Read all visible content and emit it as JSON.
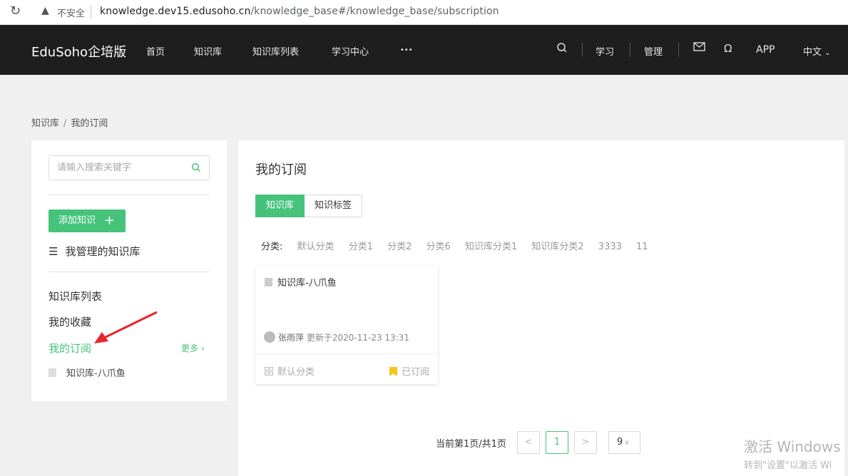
{
  "browser": {
    "insecure_label": "不安全",
    "url_host": "knowledge.dev15.edusoho.cn",
    "url_path": "/knowledge_base#/knowledge_base/subscription"
  },
  "nav": {
    "brand": "EduSoho企培版",
    "menu": [
      "首页",
      "知识库",
      "知识库列表",
      "学习中心",
      "•••"
    ],
    "learn": "学习",
    "manage": "管理",
    "app": "APP",
    "lang": "中文"
  },
  "breadcrumb": {
    "root": "知识库",
    "current": "我的订阅"
  },
  "sidebar": {
    "search_placeholder": "请输入搜索关键字",
    "add_button": "添加知识",
    "managed": "我管理的知识库",
    "links": [
      "知识库列表",
      "我的收藏",
      "我的订阅"
    ],
    "more": "更多",
    "sub_item": "知识库-八爪鱼"
  },
  "main": {
    "title": "我的订阅",
    "tabs": [
      "知识库",
      "知识标签"
    ],
    "category_label": "分类:",
    "categories": [
      "默认分类",
      "分类1",
      "分类2",
      "分类6",
      "知识库分类1",
      "知识库分类2",
      "3333",
      "11"
    ],
    "card": {
      "title": "知识库-八爪鱼",
      "author": "张雨萍",
      "updated": "更新于2020-11-23 13:31",
      "category": "默认分类",
      "status": "已订阅"
    },
    "pager": {
      "info": "当前第1页/共1页",
      "prev": "<",
      "current": "1",
      "next": ">",
      "page_size": "9"
    }
  },
  "watermark": {
    "line1": "激活 Windows",
    "line2": "转到\"设置\"以激活 Wi"
  },
  "colors": {
    "accent": "#46c37b",
    "nav_bg": "#1e1e1e"
  }
}
